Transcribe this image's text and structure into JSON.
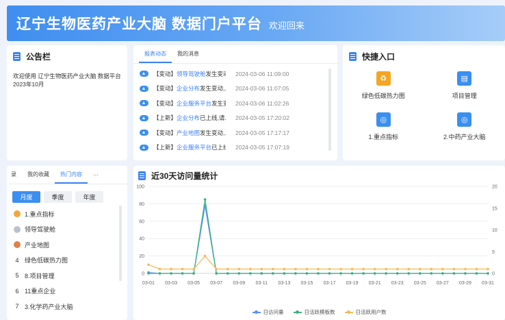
{
  "header": {
    "title": "辽宁生物医药产业大脑 数据门户平台",
    "welcome": "欢迎回来"
  },
  "notice": {
    "title": "公告栏",
    "body": "欢迎使用 辽宁生物医药产业大脑  数据平台",
    "date": "2023年10月"
  },
  "news": {
    "tabs": [
      "报表动态",
      "我的消息"
    ],
    "items": [
      {
        "tag": "【变动】",
        "name": "领导驾驶舱",
        "suffix": "发生变动...",
        "time": "2024-03-06 11:09:00"
      },
      {
        "tag": "【变动】",
        "name": "企业分布",
        "suffix": "发生变动,...",
        "time": "2024-03-06 11:07:05"
      },
      {
        "tag": "【变动】",
        "name": "企业服务平台",
        "suffix": "发生变...",
        "time": "2024-03-06 11:02:26"
      },
      {
        "tag": "【上新】",
        "name": "企业分布",
        "suffix": "已上线,请...",
        "time": "2024-03-05 17:20:02"
      },
      {
        "tag": "【变动】",
        "name": "产业地图",
        "suffix": "发生变动,...",
        "time": "2024-03-05 17:17:17"
      },
      {
        "tag": "【上新】",
        "name": "企业服务平台",
        "suffix": "已上线...",
        "time": "2024-03-05 17:07:19"
      }
    ]
  },
  "quick": {
    "title": "快捷入口",
    "items": [
      {
        "label": "绿色低碳热力图",
        "icon": "recycle-icon",
        "color": "#f5a623"
      },
      {
        "label": "项目管理",
        "icon": "document-icon",
        "color": "#3b8ff0"
      },
      {
        "label": "1.重点指标",
        "icon": "chart-search-icon",
        "color": "#3b8ff0"
      },
      {
        "label": "2.中药产业大脑",
        "icon": "chart-search-icon",
        "color": "#3b8ff0"
      }
    ]
  },
  "ranking": {
    "tabs": [
      "录",
      "我的收藏",
      "热门内容",
      "···"
    ],
    "periods": [
      "月度",
      "季度",
      "年度"
    ],
    "items": [
      {
        "rank": "1",
        "label": "1.重点指标",
        "medal": "gold"
      },
      {
        "rank": "2",
        "label": "领导驾驶舱",
        "medal": "silver"
      },
      {
        "rank": "3",
        "label": "产业地图",
        "medal": "bronze"
      },
      {
        "rank": "4",
        "label": "绿色低碳热力图",
        "medal": ""
      },
      {
        "rank": "5",
        "label": "8.项目管理",
        "medal": ""
      },
      {
        "rank": "6",
        "label": "11重点企业",
        "medal": ""
      },
      {
        "rank": "7",
        "label": "3.化学药产业大脑",
        "medal": ""
      }
    ]
  },
  "chart_title": "近30天访问量统计",
  "chart_data": {
    "type": "line",
    "title": "近30天访问量统计",
    "x": [
      "03-01",
      "03-02",
      "03-03",
      "03-04",
      "03-05",
      "03-06",
      "03-07",
      "03-08",
      "03-09",
      "03-10",
      "03-11",
      "03-12",
      "03-13",
      "03-14",
      "03-15",
      "03-16",
      "03-17",
      "03-18",
      "03-19",
      "03-20",
      "03-21",
      "03-22",
      "03-23",
      "03-24",
      "03-25",
      "03-26",
      "03-27",
      "03-28",
      "03-29",
      "03-30",
      "03-31"
    ],
    "x_tick_labels": [
      "03-01",
      "03-03",
      "03-05",
      "03-07",
      "03-09",
      "03-11",
      "03-13",
      "03-15",
      "03-17",
      "03-19",
      "03-21",
      "03-23",
      "03-25",
      "03-27",
      "03-29",
      "03-31"
    ],
    "y_left": {
      "ticks": [
        0,
        20,
        40,
        60,
        80,
        100
      ],
      "range": [
        0,
        100
      ]
    },
    "y_right": {
      "ticks": [
        0,
        5,
        10,
        15,
        20
      ],
      "range": [
        0,
        20
      ]
    },
    "series": [
      {
        "name": "日访问量",
        "axis": "left",
        "color": "#5b8ff9",
        "values": [
          1,
          0,
          0,
          0,
          0,
          78,
          0,
          0,
          0,
          0,
          0,
          0,
          0,
          0,
          0,
          0,
          0,
          0,
          0,
          0,
          0,
          0,
          0,
          0,
          0,
          0,
          0,
          0,
          0,
          0,
          0
        ]
      },
      {
        "name": "日活跃模板数",
        "axis": "right",
        "color": "#3fb27f",
        "values": [
          0,
          0,
          0,
          0,
          0,
          17,
          0,
          0,
          0,
          0,
          0,
          0,
          0,
          0,
          0,
          0,
          0,
          0,
          0,
          0,
          0,
          0,
          0,
          0,
          0,
          0,
          0,
          0,
          0,
          0,
          0
        ]
      },
      {
        "name": "日活跃用户数",
        "axis": "right",
        "color": "#f7b955",
        "values": [
          2,
          1,
          1,
          1,
          1,
          4,
          1,
          1,
          1,
          1,
          1,
          1,
          1,
          1,
          1,
          1,
          1,
          1,
          1,
          1,
          1,
          1,
          1,
          1,
          1,
          1,
          1,
          1,
          1,
          1,
          1
        ]
      }
    ],
    "legend_position": "bottom",
    "grid": true
  }
}
